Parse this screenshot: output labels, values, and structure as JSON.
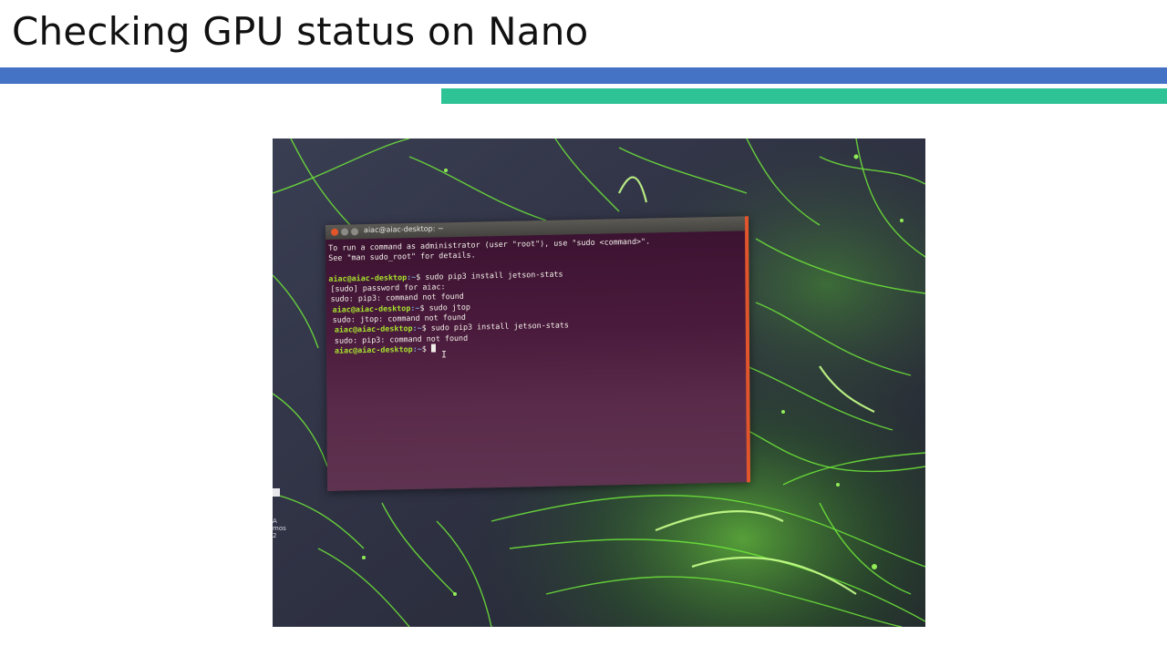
{
  "slide": {
    "title": "Checking GPU status on Nano"
  },
  "colors": {
    "blue_bar": "#4472c4",
    "green_bar": "#2ec395",
    "terminal_bg": "#4a1a3c",
    "prompt_user": "#a6e22e",
    "prompt_path": "#7a9fd6",
    "window_close": "#e2552c"
  },
  "terminal": {
    "title": "aiac@aiac-desktop: ~",
    "lines": [
      {
        "type": "text",
        "text": "To run a command as administrator (user \"root\"), use \"sudo <command>\"."
      },
      {
        "type": "text",
        "text": "See \"man sudo_root\" for details."
      },
      {
        "type": "blank",
        "text": ""
      },
      {
        "type": "prompt",
        "user": "aiac@aiac-desktop",
        "path": ":~",
        "cmd": "$ sudo pip3 install jetson-stats"
      },
      {
        "type": "text",
        "text": "[sudo] password for aiac:"
      },
      {
        "type": "text",
        "text": "sudo: pip3: command not found"
      },
      {
        "type": "prompt",
        "user": "aiac@aiac-desktop",
        "path": ":~",
        "cmd": "$ sudo jtop"
      },
      {
        "type": "text",
        "text": "sudo: jtop: command not found"
      },
      {
        "type": "prompt",
        "user": "aiac@aiac-desktop",
        "path": ":~",
        "cmd": "$ sudo pip3 install jetson-stats"
      },
      {
        "type": "text",
        "text": "sudo: pip3: command not found"
      },
      {
        "type": "prompt",
        "user": "aiac@aiac-desktop",
        "path": ":~",
        "cmd": "$ "
      }
    ]
  },
  "desktop_side_labels": [
    "A",
    "mos",
    "2"
  ],
  "icons": {
    "close": "close-icon",
    "minimize": "minimize-icon",
    "maximize": "maximize-icon",
    "cursor": "text-cursor-icon"
  }
}
